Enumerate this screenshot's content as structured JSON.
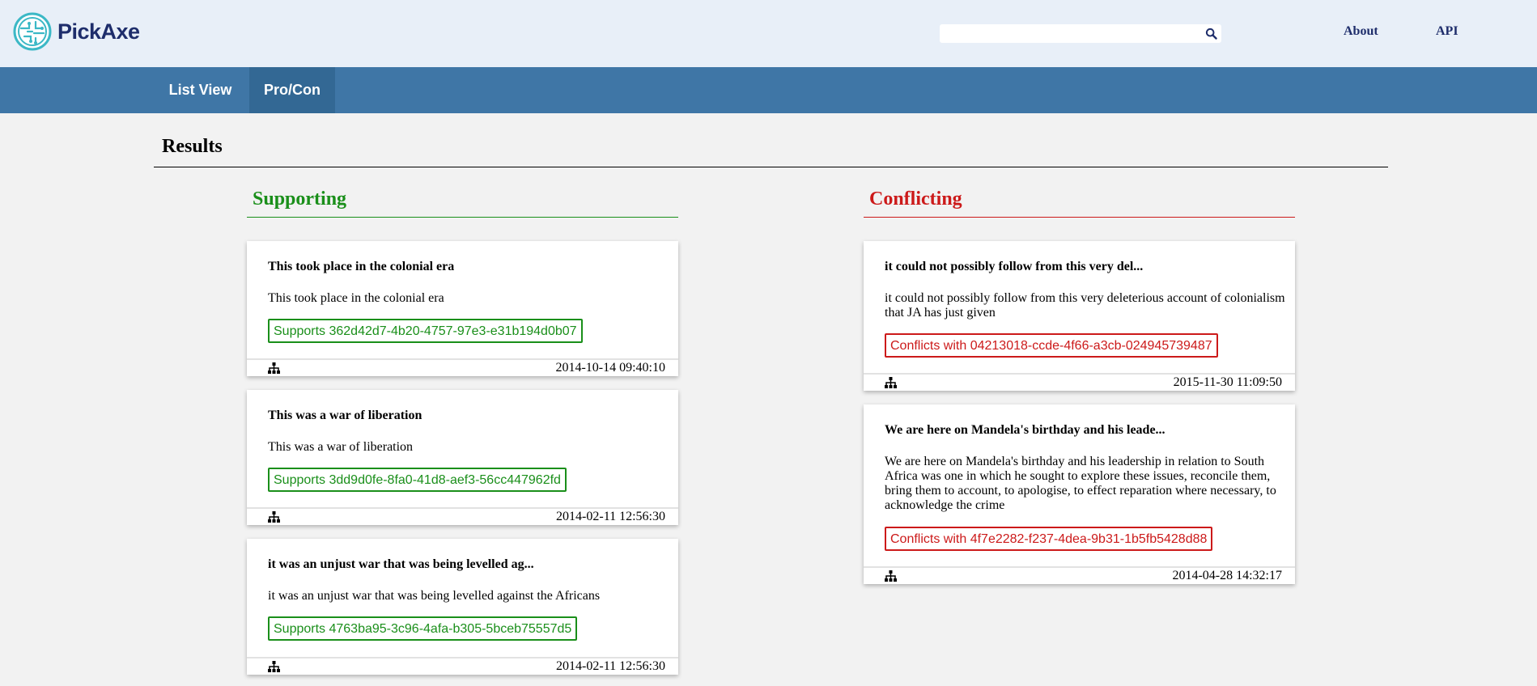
{
  "app": {
    "name": "PickAxe"
  },
  "header": {
    "search": {
      "value": "",
      "placeholder": ""
    },
    "links": [
      "About",
      "API"
    ]
  },
  "nav": {
    "tabs": [
      "List View",
      "Pro/Con"
    ],
    "active_tab": "Pro/Con"
  },
  "results": {
    "title": "Results",
    "supporting": {
      "title": "Supporting",
      "items": [
        {
          "title": "This took place in the colonial era",
          "body": "This took place in the colonial era",
          "tag": "Supports 362d42d7-4b20-4757-97e3-e31b194d0b07",
          "timestamp": "2014-10-14 09:40:10"
        },
        {
          "title": "This was a war of liberation",
          "body": "This was a war of liberation",
          "tag": "Supports 3dd9d0fe-8fa0-41d8-aef3-56cc447962fd",
          "timestamp": "2014-02-11 12:56:30"
        },
        {
          "title": "it was an unjust war that was being levelled ag...",
          "body": "it was an unjust war that was being levelled against the Africans",
          "tag": "Supports 4763ba95-3c96-4afa-b305-5bceb75557d5",
          "timestamp": "2014-02-11 12:56:30"
        }
      ]
    },
    "conflicting": {
      "title": "Conflicting",
      "items": [
        {
          "title": "it could not possibly follow from this very del...",
          "body": "it could not possibly follow from this very deleterious account of colonialism that JA has just given",
          "tag": "Conflicts with 04213018-ccde-4f66-a3cb-024945739487",
          "timestamp": "2015-11-30 11:09:50"
        },
        {
          "title": "We are here on Mandela's birthday and his leade...",
          "body": "We are here on Mandela's birthday and his leadership in relation to South Africa was one in which he sought to explore these issues, reconcile them, bring them to account, to apologise, to effect reparation where necessary, to acknowledge the crime",
          "tag": "Conflicts with 4f7e2282-f237-4dea-9b31-1b5fb5428d88",
          "timestamp": "2014-04-28 14:32:17"
        }
      ]
    }
  },
  "colors": {
    "header_bg": "#e8eff8",
    "nav_bg": "#3f76a6",
    "nav_active_bg": "#336894",
    "brand": "#1e2d6b",
    "supporting": "#1a8f1a",
    "conflicting": "#cc1a1a",
    "page_bg": "#f2f2f2"
  },
  "icons": [
    "pickaxe-logo-icon",
    "search-icon",
    "tree-structure-icon"
  ]
}
